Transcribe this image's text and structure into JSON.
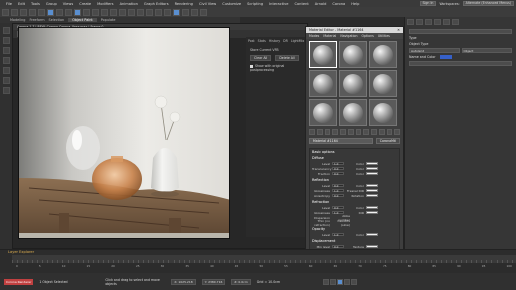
{
  "menubar": {
    "items": [
      "File",
      "Edit",
      "Tools",
      "Group",
      "Views",
      "Create",
      "Modifiers",
      "Animation",
      "Graph Editors",
      "Rendering",
      "Civil View",
      "Customize",
      "Scripting",
      "Interactive",
      "Content",
      "Arnold",
      "Corona",
      "Help"
    ],
    "sign_in": "Sign In",
    "workspace": "Workspaces:",
    "workspace_value": "Alternate (Enhanced Menus)"
  },
  "ribbon_tabs": [
    "Modeling",
    "Freeform",
    "Selection",
    "Object Paint",
    "Populate"
  ],
  "ribbon_active": "Object Paint",
  "ribbon_row2": [
    "Basic Objects",
    "Graph Settings"
  ],
  "frame_window": {
    "title": "Corona 1.7 | RFW: Corona Corona_Vase.max | Frame 0",
    "tools": {
      "save": "Save",
      "copy": "Copy",
      "clear": "Clear",
      "refresh": "Refresh",
      "stop": "Stop",
      "setup": "Setup",
      "pick": "Pick",
      "channel": "Beauty",
      "channel_value": "Corona_Vase(max)"
    },
    "side": {
      "tabs": [
        "Post",
        "Stats",
        "History",
        "DR",
        "LightMix"
      ],
      "store_label": "Store Current VFB",
      "clear_all": "Clear All",
      "delete_all": "Delete All",
      "checkbox": "Show with original postprocessing"
    }
  },
  "material_editor": {
    "title": "Material Editor - Material #1164",
    "menu": [
      "Modes",
      "Material",
      "Navigation",
      "Options",
      "Utilities"
    ],
    "slot_count": 9,
    "name": "Material #1164",
    "type": "CoronaMtl",
    "basic_options": "Basic options",
    "sections": [
      {
        "title": "Diffuse",
        "rows": [
          [
            "Level",
            "1.0",
            "Color"
          ],
          [
            "Translucency",
            "0.0",
            "Color"
          ],
          [
            "Fraction",
            "0.0",
            "Color"
          ]
        ]
      },
      {
        "title": "Reflection",
        "rows": [
          [
            "Level",
            "0.0",
            "Color"
          ],
          [
            "Glossiness",
            "1.0",
            "Fresnel IOR"
          ],
          [
            "Anisotropy",
            "0.0",
            "Rotation"
          ]
        ]
      },
      {
        "title": "Refraction",
        "rows": [
          [
            "Level",
            "0.0",
            "Color"
          ],
          [
            "Glossiness",
            "1.0",
            "IOR"
          ],
          [
            "Dispersion",
            "Abbe number"
          ],
          [
            "Thin (no refraction)",
            "Caustics (slow)"
          ]
        ]
      },
      {
        "title": "Opacity",
        "rows": [
          [
            "Level",
            "1.0",
            "Color"
          ]
        ]
      },
      {
        "title": "Displacement",
        "rows": [
          [
            "Min level",
            "0.0",
            "Texture"
          ],
          [
            "Max level",
            "1.0",
            "Water lev."
          ]
        ]
      }
    ]
  },
  "command_panel": {
    "type_label": "Type",
    "object_type": "Object Type",
    "autogrid": "AutoGrid",
    "name_color": "Name and Color",
    "object_name": "Object",
    "swatch": "#3660c9"
  },
  "scene": {
    "layer": "Layer Explorer",
    "ticks": [
      "0",
      "5",
      "10",
      "15",
      "20",
      "25",
      "30",
      "35",
      "40",
      "45",
      "50",
      "55",
      "60",
      "65",
      "70",
      "75",
      "80",
      "85",
      "90",
      "95",
      "100"
    ],
    "status_corona": "Corona Renderer",
    "status_msg": "1 Object Selected",
    "status_hint": "Click and drag to select and move objects",
    "x": "X: 1025.218",
    "y": "Y: 2380.716",
    "z": "Z: 0.0cm",
    "grid": "Grid = 10.0cm",
    "addtime": "Add Time Tag",
    "autokey": "Auto Key",
    "selected": "Selected",
    "setkey": "Set Key",
    "keyfilters": "Key Filters..."
  }
}
